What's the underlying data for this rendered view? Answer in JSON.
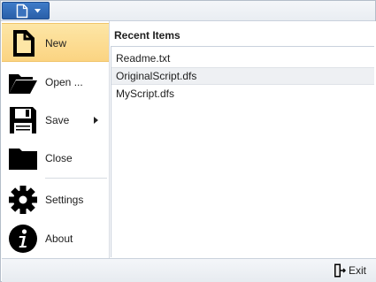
{
  "app_menu": {
    "button_icon": "document-icon",
    "button_caret": "chevron-down-icon"
  },
  "menu": {
    "items": [
      {
        "label": "New",
        "icon": "new-document-icon",
        "selected": true
      },
      {
        "label": "Open ...",
        "icon": "open-folder-icon"
      },
      {
        "label": "Save",
        "icon": "floppy-disk-icon",
        "has_submenu": true
      },
      {
        "label": "Close",
        "icon": "folder-icon"
      },
      {
        "label": "Settings",
        "icon": "gear-icon"
      },
      {
        "label": "About",
        "icon": "info-icon"
      }
    ]
  },
  "recent": {
    "title": "Recent Items",
    "items": [
      "Readme.txt",
      "OriginalScript.dfs",
      "MyScript.dfs"
    ]
  },
  "footer": {
    "exit_label": "Exit",
    "exit_icon": "exit-door-icon"
  },
  "colors": {
    "accent": "#2a5fa8",
    "selected_bg": "#fbd482",
    "hover_bg": "#eef0f3"
  }
}
